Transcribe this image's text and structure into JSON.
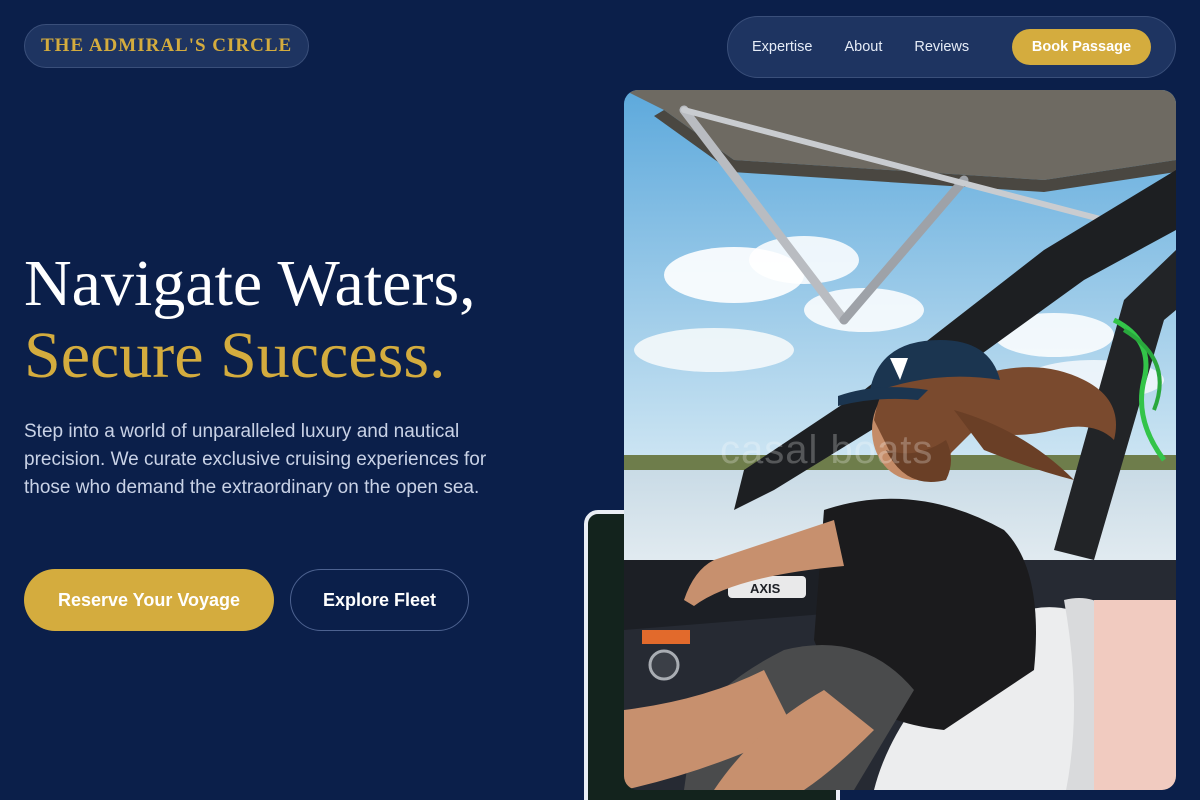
{
  "brand": {
    "name": "THE ADMIRAL'S CIRCLE"
  },
  "nav": {
    "links": [
      "Expertise",
      "About",
      "Reviews"
    ],
    "cta": "Book Passage"
  },
  "hero": {
    "title_line1": "Navigate Waters,",
    "title_line2": "Secure Success.",
    "description": "Step into a world of unparalleled luxury and nautical precision. We curate exclusive cruising experiences for those who demand the extraordinary on the open sea.",
    "primary_button": "Reserve Your Voyage",
    "secondary_button": "Explore Fleet"
  },
  "photo": {
    "watermark": "casal boats",
    "console_badge": "AXIS"
  },
  "colors": {
    "background": "#0b1f4a",
    "accent_gold": "#d4ac3e",
    "pill_surface": "#1e3461"
  }
}
